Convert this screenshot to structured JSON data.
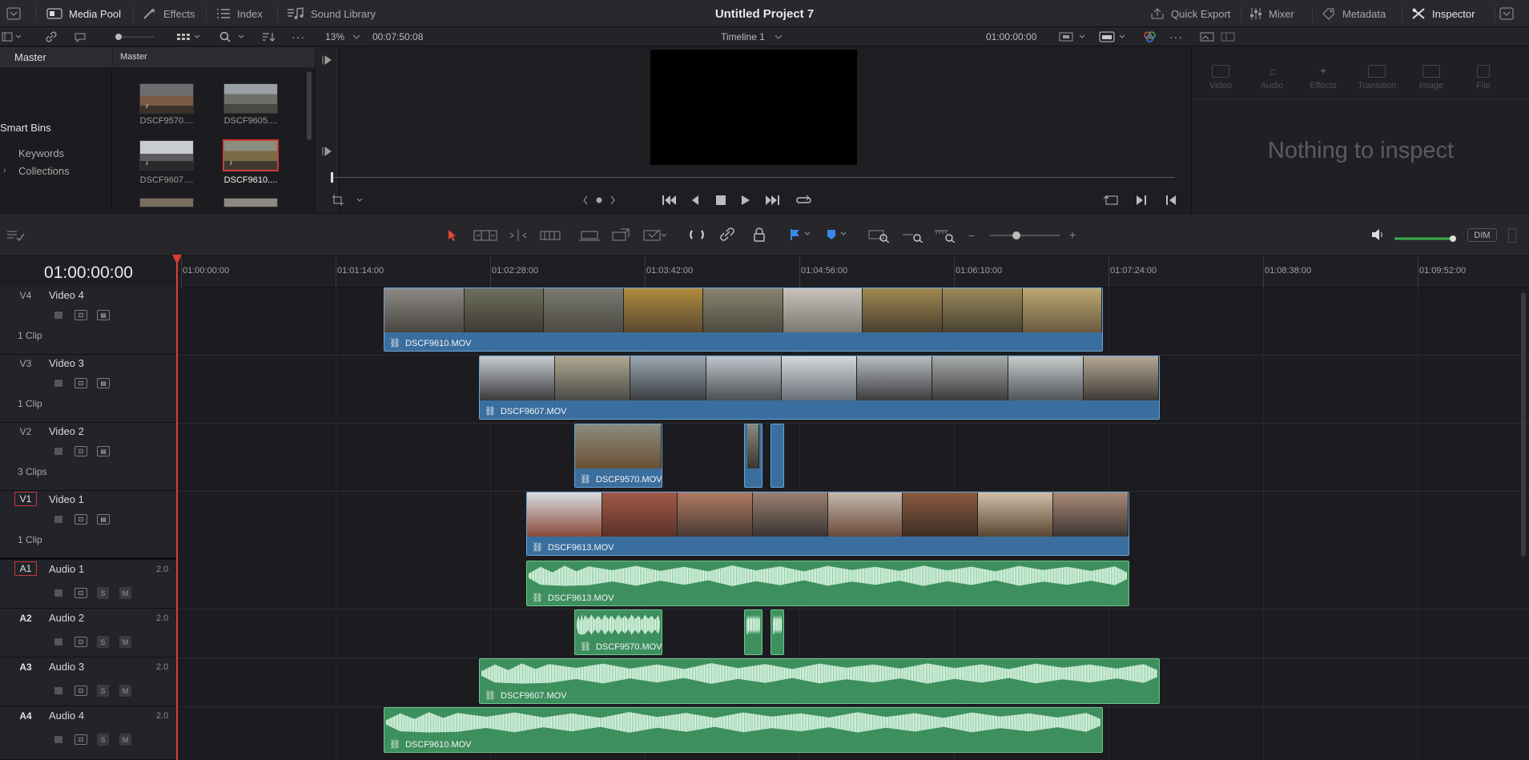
{
  "topbar": {
    "media_pool": "Media Pool",
    "effects": "Effects",
    "index": "Index",
    "sound_library": "Sound Library",
    "project_title": "Untitled Project 7",
    "quick_export": "Quick Export",
    "mixer": "Mixer",
    "metadata": "Metadata",
    "inspector": "Inspector"
  },
  "toolbar2": {
    "zoom": "13%",
    "duration": "00:07:50:08",
    "timeline_name": "Timeline 1",
    "timecode": "01:00:00:00"
  },
  "bins": {
    "master": "Master",
    "smart_bins": "Smart Bins",
    "keywords": "Keywords",
    "collections": "Collections"
  },
  "pool": {
    "header": "Master",
    "clips": [
      {
        "label": "DSCF9570...."
      },
      {
        "label": "DSCF9605...."
      },
      {
        "label": "DSCF9607...."
      },
      {
        "label": "DSCF9610...."
      }
    ]
  },
  "inspector": {
    "tabs": [
      "Video",
      "Audio",
      "Effects",
      "Transition",
      "Image",
      "File"
    ],
    "empty": "Nothing to inspect"
  },
  "timeline_tools": {
    "dim": "DIM",
    "volume_level": 0.85
  },
  "timeline": {
    "current_timecode": "01:00:00:00",
    "ruler": [
      "01:00:00:00",
      "01:01:14:00",
      "01:02:28:00",
      "01:03:42:00",
      "01:04:56:00",
      "01:06:10:00",
      "01:07:24:00",
      "01:08:38:00",
      "01:09:52:00"
    ],
    "video_tracks": [
      {
        "id": "V4",
        "name": "Video 4",
        "clips": "1 Clip"
      },
      {
        "id": "V3",
        "name": "Video 3",
        "clips": "1 Clip"
      },
      {
        "id": "V2",
        "name": "Video 2",
        "clips": "3 Clips"
      },
      {
        "id": "V1",
        "name": "Video 1",
        "clips": "1 Clip"
      }
    ],
    "audio_tracks": [
      {
        "id": "A1",
        "name": "Audio 1",
        "channels": "2.0",
        "s": "S",
        "m": "M"
      },
      {
        "id": "A2",
        "name": "Audio 2",
        "channels": "2.0",
        "s": "S",
        "m": "M"
      },
      {
        "id": "A3",
        "name": "Audio 3",
        "channels": "2.0",
        "s": "S",
        "m": "M"
      },
      {
        "id": "A4",
        "name": "Audio 4",
        "channels": "2.0",
        "s": "S",
        "m": "M"
      }
    ],
    "clip_names": {
      "v4": "DSCF9610.MOV",
      "v3": "DSCF9607.MOV",
      "v2": "DSCF9570.MOV",
      "v1": "DSCF9613.MOV",
      "a1": "DSCF9613.MOV",
      "a2": "DSCF9570.MOV",
      "a3": "DSCF9607.MOV",
      "a4": "DSCF9610.MOV"
    }
  },
  "colors": {
    "video_clip": "#3a6e9e",
    "audio_clip": "#3e8f5e",
    "playhead": "#e23a3a",
    "selection": "#d23b3b"
  }
}
